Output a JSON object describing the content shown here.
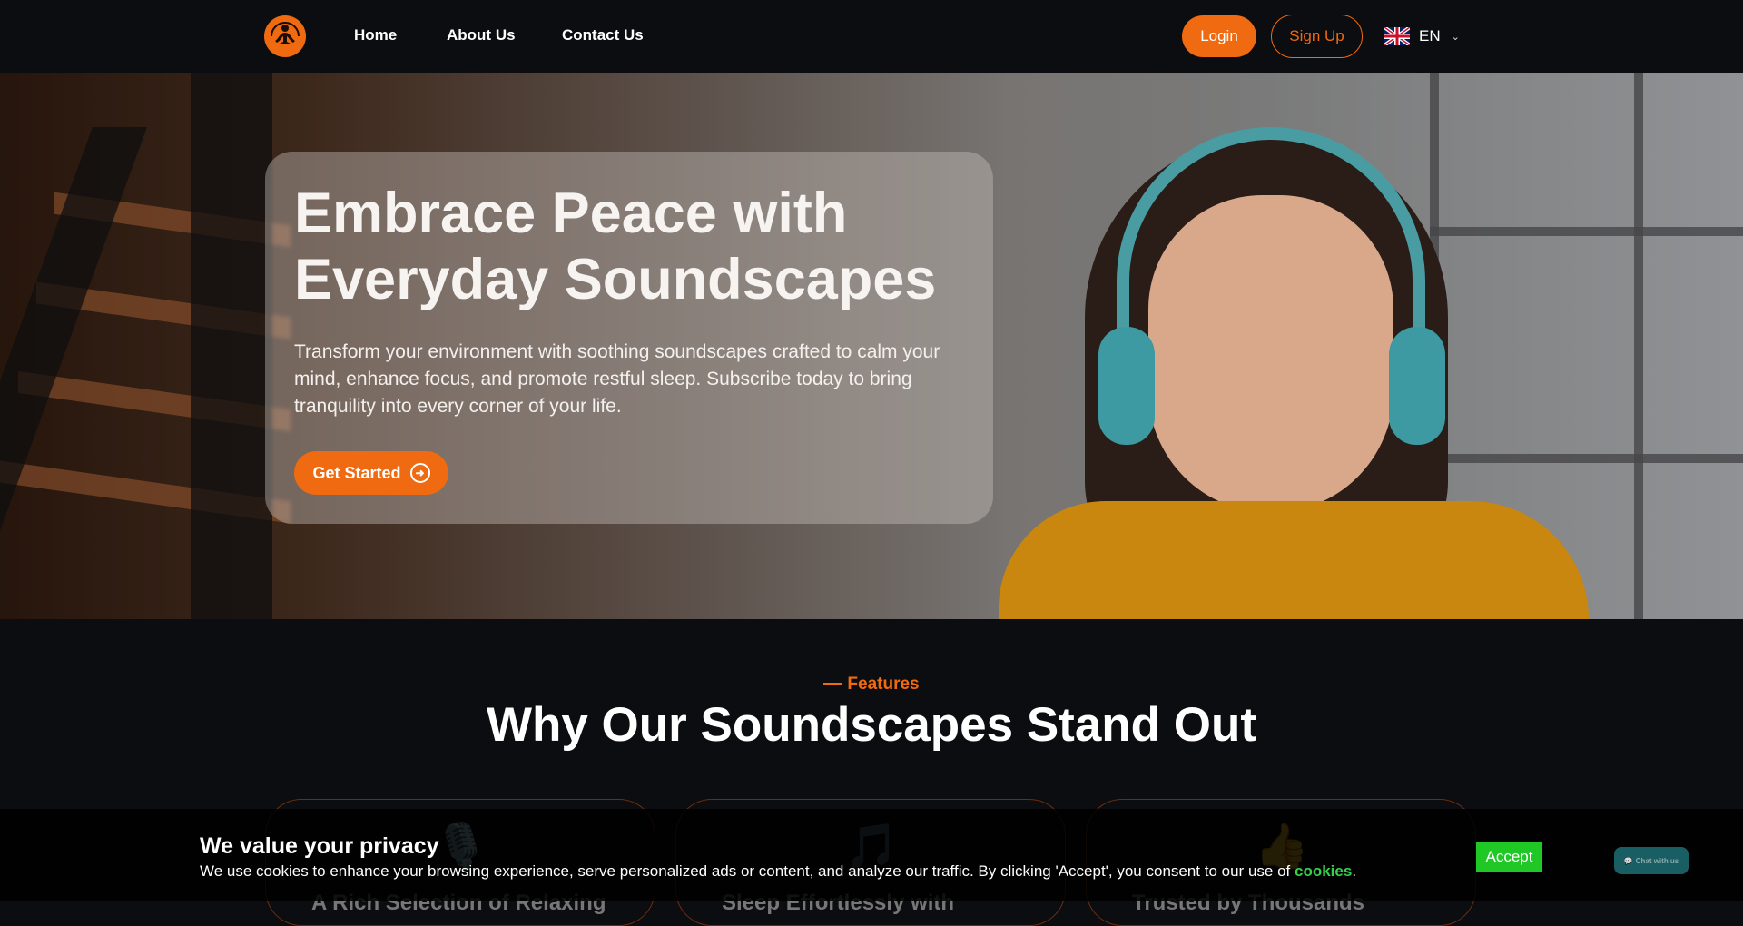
{
  "nav": {
    "links": [
      "Home",
      "About Us",
      "Contact Us"
    ],
    "login_label": "Login",
    "signup_label": "Sign Up",
    "language": "EN"
  },
  "hero": {
    "title": "Embrace Peace with Everyday Soundscapes",
    "description": "Transform your environment with soothing soundscapes crafted to calm your mind, enhance focus, and promote restful sleep. Subscribe today to bring tranquility into every corner of your life.",
    "cta_label": "Get Started"
  },
  "features": {
    "tag": "Features",
    "title": "Why Our Soundscapes Stand Out",
    "cards": [
      {
        "icon": "🎙️",
        "title": "A Rich Selection of Relaxing"
      },
      {
        "icon": "🎵",
        "title": "Sleep Effortlessly with"
      },
      {
        "icon": "👍",
        "title": "Trusted by Thousands"
      }
    ]
  },
  "cookie": {
    "title": "We value your privacy",
    "text": "We use cookies to enhance your browsing experience, serve personalized ads or content, and analyze our traffic. By clicking 'Accept', you consent to our use of",
    "link": "cookies",
    "period": ".",
    "accept_label": "Accept"
  },
  "chat": {
    "label": "Chat with us"
  },
  "colors": {
    "accent": "#ef6a10",
    "background": "#0c0d10",
    "accept": "#1fc825",
    "cookie_link": "#35d34b"
  }
}
